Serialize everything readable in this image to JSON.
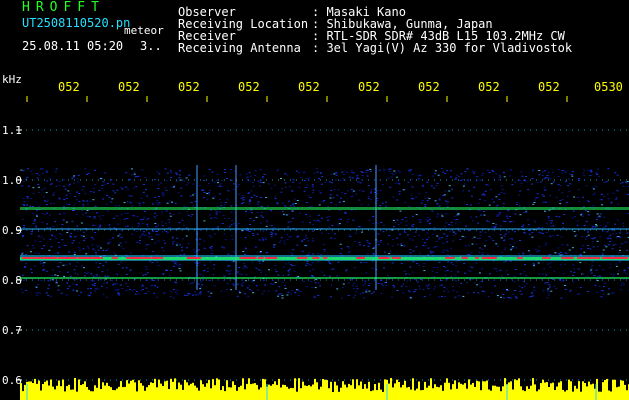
{
  "header": {
    "logo": "HROFFT",
    "filename": "UT2508110520.pn",
    "mode": "meteor",
    "datetime": "25.08.11 05:20",
    "extra": "3.."
  },
  "info": [
    {
      "label": "Observer",
      "value": ": Masaki Kano"
    },
    {
      "label": "Receiving Location",
      "value": ": Shibukawa, Gunma, Japan"
    },
    {
      "label": "Receiver",
      "value": ": RTL-SDR SDR# 43dB L15 103.2MHz CW"
    },
    {
      "label": "Receiving Antenna",
      "value": ": 3el Yagi(V) Az 330 for Vladivostok"
    }
  ],
  "axis": {
    "unit": "kHz",
    "time_ticks": [
      "052",
      "052",
      "052",
      "052",
      "052",
      "052",
      "052",
      "052",
      "052",
      "0530"
    ],
    "freq_ticks": [
      "1.1",
      "1.0",
      "0.9",
      "0.8",
      "0.7",
      "0.6"
    ]
  },
  "colors": {
    "background": "#000000",
    "noise_blue": "#1a3cff",
    "band_green": "#22ff66",
    "band_red": "#ff2244",
    "grid_cyan": "#22d8ff",
    "tick_yellow": "#ffff00"
  }
}
